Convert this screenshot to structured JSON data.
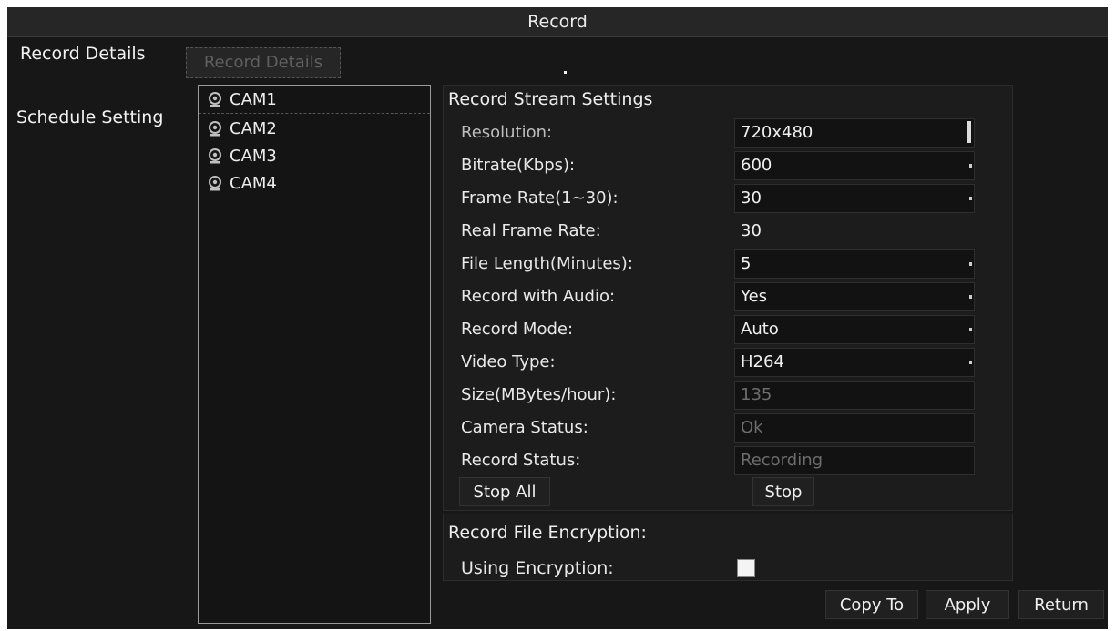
{
  "window": {
    "title": "Record"
  },
  "sidebar": {
    "items": [
      {
        "label": "Record Details"
      },
      {
        "label": "Schedule Setting"
      }
    ]
  },
  "subtab": {
    "label": "Record Details"
  },
  "cameras": {
    "items": [
      {
        "label": "CAM1",
        "icon": "camera-icon"
      },
      {
        "label": "CAM2",
        "icon": "camera-icon"
      },
      {
        "label": "CAM3",
        "icon": "camera-icon"
      },
      {
        "label": "CAM4",
        "icon": "camera-icon"
      }
    ]
  },
  "stream": {
    "title": "Record Stream Settings",
    "resolution": {
      "label": "Resolution:",
      "value": "720x480"
    },
    "bitrate": {
      "label": "Bitrate(Kbps):",
      "value": "600"
    },
    "frame_rate": {
      "label": "Frame Rate(1~30):",
      "value": "30"
    },
    "real_frame_rate": {
      "label": "Real Frame Rate:",
      "value": "30"
    },
    "file_length": {
      "label": "File Length(Minutes):",
      "value": "5"
    },
    "record_audio": {
      "label": "Record with Audio:",
      "value": "Yes"
    },
    "record_mode": {
      "label": "Record Mode:",
      "value": "Auto"
    },
    "video_type": {
      "label": "Video Type:",
      "value": "H264"
    },
    "size": {
      "label": "Size(MBytes/hour):",
      "value": "135"
    },
    "camera_status": {
      "label": "Camera Status:",
      "value": "Ok"
    },
    "record_status": {
      "label": "Record Status:",
      "value": "Recording"
    },
    "stop_all_label": "Stop All",
    "stop_label": "Stop"
  },
  "encryption": {
    "title": "Record File Encryption:",
    "using_label": "Using Encryption:",
    "checked": false
  },
  "footer": {
    "copy_to_label": "Copy To",
    "apply_label": "Apply",
    "return_label": "Return"
  },
  "colors": {
    "background": "#171717",
    "panel": "#1c1c1c",
    "text": "#e6e6e6",
    "disabled_text": "#6d6d6d"
  }
}
